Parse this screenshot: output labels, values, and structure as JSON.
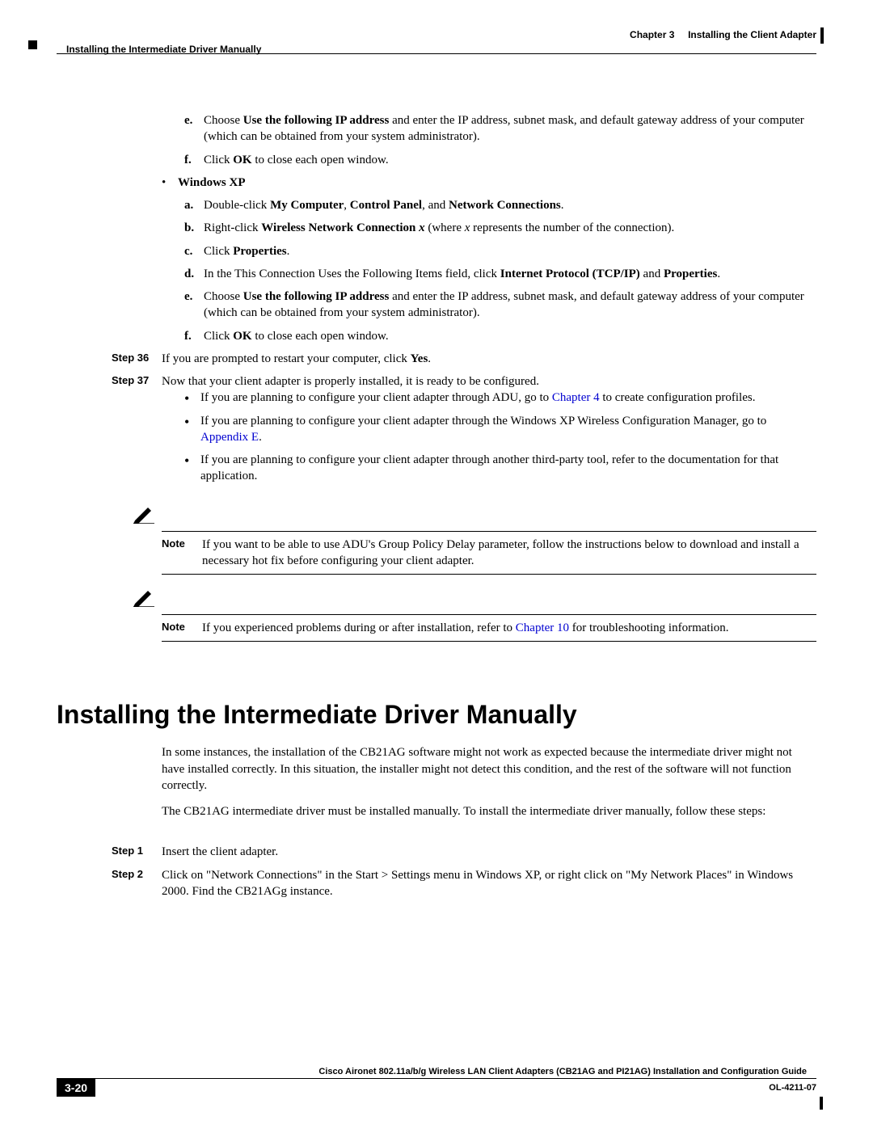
{
  "header": {
    "chapter_label": "Chapter 3",
    "chapter_title": "Installing the Client Adapter",
    "section_title": "Installing the Intermediate Driver Manually"
  },
  "content": {
    "e1_prefix": "Choose ",
    "e1_bold": "Use the following IP address",
    "e1_suffix": " and enter the IP address, subnet mask, and default gateway address of your computer (which can be obtained from your system administrator).",
    "f1_prefix": "Click ",
    "f1_bold": "OK",
    "f1_suffix": " to close each open window.",
    "winxp_label": "Windows XP",
    "xp_a_prefix": "Double-click ",
    "xp_a_b1": "My Computer",
    "xp_a_mid1": ", ",
    "xp_a_b2": "Control Panel",
    "xp_a_mid2": ", and ",
    "xp_a_b3": "Network Connections",
    "xp_a_suffix": ".",
    "xp_b_prefix": "Right-click ",
    "xp_b_bold": "Wireless Network Connection ",
    "xp_b_ital": "x",
    "xp_b_mid": " (where ",
    "xp_b_ital2": "x",
    "xp_b_suffix": " represents the number of the connection).",
    "xp_c_prefix": "Click ",
    "xp_c_bold": "Properties",
    "xp_c_suffix": ".",
    "xp_d_prefix": "In the This Connection Uses the Following Items field, click ",
    "xp_d_b1": "Internet Protocol (TCP/IP)",
    "xp_d_mid": " and ",
    "xp_d_b2": "Properties",
    "xp_d_suffix": ".",
    "xp_e_prefix": "Choose ",
    "xp_e_bold": "Use the following IP address",
    "xp_e_suffix": " and enter the IP address, subnet mask, and default gateway address of your computer (which can be obtained from your system administrator).",
    "xp_f_prefix": "Click ",
    "xp_f_bold": "OK",
    "xp_f_suffix": " to close each open window.",
    "step36_label": "Step 36",
    "step36_prefix": "If you are prompted to restart your computer, click ",
    "step36_bold": "Yes",
    "step36_suffix": ".",
    "step37_label": "Step 37",
    "step37_text": "Now that your client adapter is properly installed, it is ready to be configured.",
    "s37_b1_prefix": "If you are planning to configure your client adapter through ADU, go to ",
    "s37_b1_link": "Chapter 4",
    "s37_b1_suffix": " to create configuration profiles.",
    "s37_b2_prefix": "If you are planning to configure your client adapter through the Windows XP Wireless Configuration Manager, go to ",
    "s37_b2_link": "Appendix E",
    "s37_b2_suffix": ".",
    "s37_b3": "If you are planning to configure your client adapter through another third-party tool, refer to the documentation for that application.",
    "note_label": "Note",
    "note1_text": "If you want to be able to use ADU's Group Policy Delay parameter, follow the instructions below to download and install a necessary hot fix before configuring your client adapter.",
    "note2_prefix": "If you experienced problems during or after installation, refer to ",
    "note2_link": "Chapter 10",
    "note2_suffix": " for troubleshooting information.",
    "h1": "Installing the Intermediate Driver Manually",
    "intro1": "In some instances, the installation of the CB21AG software might not work as expected because the intermediate driver might not have installed correctly. In this situation, the installer might not detect this condition, and the rest of the software will not function correctly.",
    "intro2": "The CB21AG intermediate driver must be installed manually. To install the intermediate driver manually, follow these steps:",
    "m_step1_label": "Step 1",
    "m_step1_text": "Insert the client adapter.",
    "m_step2_label": "Step 2",
    "m_step2_text": "Click on \"Network Connections\" in the Start > Settings menu in Windows XP, or right click on \"My Network Places\" in Windows 2000. Find the CB21AGg instance."
  },
  "footer": {
    "guide_title": "Cisco Aironet 802.11a/b/g Wireless LAN Client Adapters (CB21AG and PI21AG) Installation and Configuration Guide",
    "page_num": "3-20",
    "doc_id": "OL-4211-07"
  },
  "markers": {
    "e": "e.",
    "f": "f.",
    "a": "a.",
    "b": "b.",
    "c": "c.",
    "d": "d."
  }
}
